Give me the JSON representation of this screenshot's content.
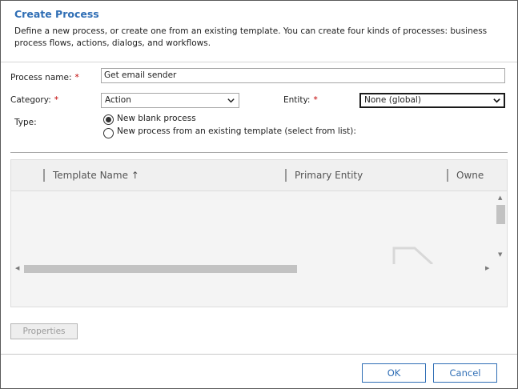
{
  "dialog": {
    "title": "Create Process",
    "description": "Define a new process, or create one from an existing template. You can create four kinds of processes: business process flows, actions, dialogs, and workflows."
  },
  "form": {
    "process_name_label": "Process name:",
    "process_name_value": "Get email sender",
    "category_label": "Category:",
    "category_value": "Action",
    "entity_label": "Entity:",
    "entity_value": "None (global)",
    "type_label": "Type:",
    "required_marker": "*",
    "type_options": [
      {
        "label": "New blank process",
        "selected": true
      },
      {
        "label": "New process from an existing template (select from list):",
        "selected": false
      }
    ]
  },
  "grid": {
    "columns": [
      "Template Name ↑",
      "Primary Entity",
      "Owne"
    ]
  },
  "buttons": {
    "properties": "Properties",
    "ok": "OK",
    "cancel": "Cancel"
  },
  "colors": {
    "accent": "#2f6eb5",
    "required": "#c00000"
  }
}
